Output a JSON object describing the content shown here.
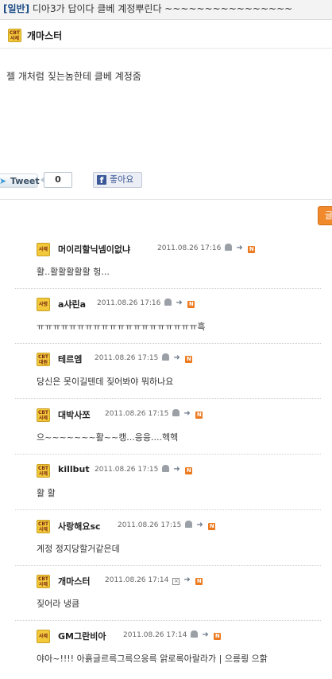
{
  "post": {
    "category": "[일반]",
    "title": "디아3가 답이다 클베 계정뿌린다 ~~~~~~~~~~~~~~~~",
    "author": {
      "badge": [
        "CBT",
        "사제"
      ],
      "name": "개마스터"
    },
    "body": "젤 개처럼 짖는놈한테 클베 계정줌"
  },
  "social": {
    "tweet_label": "Tweet",
    "tweet_count": "0",
    "like_label": "좋아요"
  },
  "write_button": "글",
  "comments": [
    {
      "badge": [
        "",
        "사제"
      ],
      "nick": "머이리할닉넴이없냐",
      "date": "2011.08.26 17:16",
      "text": "활..활활활활활 헝..."
    },
    {
      "badge": [
        "",
        "사령"
      ],
      "nick": "a샤린a",
      "date": "2011.08.26 17:16",
      "text": "ㅠㅠㅠㅠㅠㅠㅠㅠㅠㅠㅠㅠㅠㅠㅠㅠㅠㅠㅠㅠ흑"
    },
    {
      "badge": [
        "CBT",
        "대원"
      ],
      "nick": "테르엠",
      "date": "2011.08.26 17:15",
      "text": "당신은 못이길텐데 짖어봐야 뭐하나요"
    },
    {
      "badge": [
        "CBT",
        "사제"
      ],
      "nick": "대박사쪼",
      "date": "2011.08.26 17:15",
      "text": "으~~~~~~~활~~캥...응응....헥헥"
    },
    {
      "badge": [
        "CBT",
        "사제"
      ],
      "nick": "killbut",
      "date": "2011.08.26 17:15",
      "text": "활 활"
    },
    {
      "badge": [
        "CBT",
        "사제"
      ],
      "nick": "사랑해요sc",
      "date": "2011.08.26 17:15",
      "text": "계정 정지당할거같은데"
    },
    {
      "badge": [
        "CBT",
        "사제"
      ],
      "nick": "개마스터",
      "date": "2011.08.26 17:14",
      "text": "짖어라 냉큼"
    },
    {
      "badge": [
        "",
        "사제"
      ],
      "nick": "GM그란비아",
      "date": "2011.08.26 17:14",
      "text": "야아~!!!! 아흙글르륵그륵으응륵 앍로록아랄라가 | 으릉릥 으핡"
    }
  ]
}
